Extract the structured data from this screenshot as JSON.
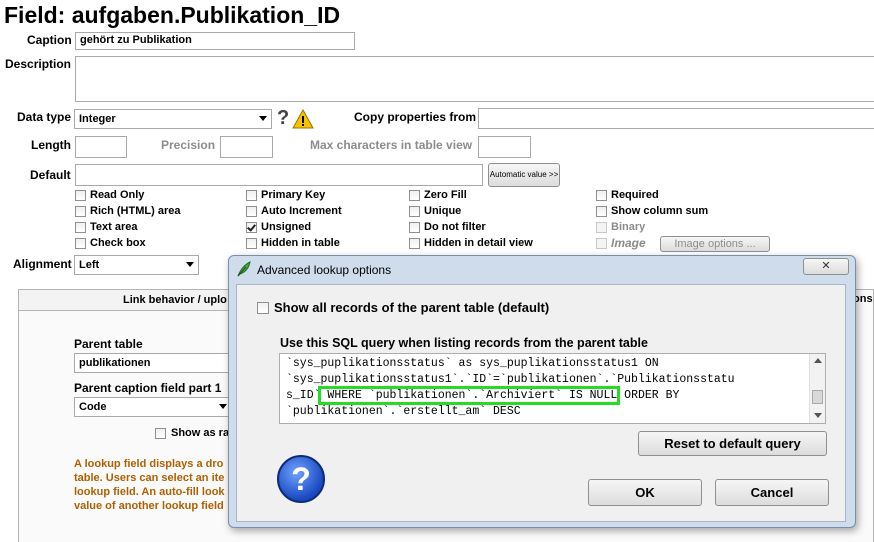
{
  "page": {
    "title": "Field: aufgaben.Publikation_ID"
  },
  "form": {
    "caption_label": "Caption",
    "caption_value": "gehört zu Publikation",
    "description_label": "Description",
    "description_value": "",
    "data_type_label": "Data type",
    "data_type_value": "Integer",
    "copy_props_label": "Copy properties from",
    "copy_props_value": "",
    "length_label": "Length",
    "length_value": "",
    "precision_label": "Precision",
    "precision_value": "",
    "max_chars_label": "Max characters in table view",
    "max_chars_value": "",
    "default_label": "Default",
    "default_value": "",
    "automatic_value_button": "Automatic value >>",
    "alignment_label": "Alignment",
    "alignment_value": "Left",
    "image_options_button": "Image options ..."
  },
  "checkboxes": {
    "read_only": "Read Only",
    "rich_html": "Rich (HTML) area",
    "text_area": "Text area",
    "check_box": "Check box",
    "primary_key": "Primary Key",
    "auto_increment": "Auto Increment",
    "unsigned": "Unsigned",
    "hidden_in_table": "Hidden in table",
    "zero_fill": "Zero Fill",
    "unique": "Unique",
    "do_not_filter": "Do not filter",
    "hidden_in_detail": "Hidden in detail view",
    "required": "Required",
    "show_column_sum": "Show column sum",
    "binary": "Binary",
    "image": "Image"
  },
  "tabs": {
    "tab1_label": "Link behavior / uplo",
    "tab2_label": "ons"
  },
  "lookup": {
    "parent_table_label": "Parent table",
    "parent_table_value": "publikationen",
    "caption_part1_label": "Parent caption field part 1",
    "caption_part1_value": "Code",
    "show_as_label": "Show as ra",
    "info_lines": [
      "A lookup field displays a dro",
      "table. Users can select an ite",
      "lookup field. An auto-fill look",
      "value of another lookup field"
    ]
  },
  "dialog": {
    "title": "Advanced lookup options",
    "show_all_label": "Show all records of the parent table (default)",
    "sql_heading": "Use this SQL query when listing records from the parent table",
    "sql_lines": [
      "`sys_puplikationsstatus` as sys_puplikationsstatus1 ON",
      "`sys_puplikationsstatus1`.`ID`=`publikationen`.`Publikationsstatu",
      "s_ID`",
      " WHERE `publikationen`.`Archiviert` IS NULL",
      " ORDER BY",
      "`publikationen`.`erstellt_am` DESC"
    ],
    "reset_button": "Reset to default query",
    "ok_button": "OK",
    "cancel_button": "Cancel",
    "help_glyph": "?",
    "close_glyph": "✕"
  },
  "colors": {
    "highlight": "#22dd22",
    "info_text": "#b06000",
    "dialog_frame": "#cfdcec"
  }
}
